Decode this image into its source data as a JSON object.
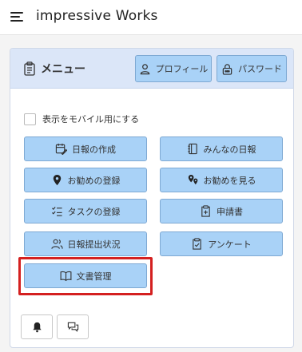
{
  "app": {
    "title": "impressive Works"
  },
  "card": {
    "title": "メニュー",
    "profile_label": "プロフィール",
    "password_label": "パスワード"
  },
  "mobile_toggle": {
    "label": "表示をモバイル用にする",
    "checked": false
  },
  "menu_buttons": [
    {
      "label": "日報の作成",
      "icon": "calendar-edit-icon"
    },
    {
      "label": "みんなの日報",
      "icon": "notebook-icon"
    },
    {
      "label": "お勧めの登録",
      "icon": "map-pin-icon"
    },
    {
      "label": "お勧めを見る",
      "icon": "map-pins-icon"
    },
    {
      "label": "タスクの登録",
      "icon": "checklist-icon"
    },
    {
      "label": "申請書",
      "icon": "clipboard-plus-icon"
    },
    {
      "label": "日報提出状況",
      "icon": "users-icon"
    },
    {
      "label": "アンケート",
      "icon": "clipboard-check-icon"
    },
    {
      "label": "文書管理",
      "icon": "open-book-icon"
    }
  ],
  "bottom_buttons": [
    {
      "icon": "bell-icon"
    },
    {
      "icon": "chat-bubbles-icon"
    }
  ],
  "colors": {
    "button_fill": "#a9d2f7",
    "header_fill": "#dbe6f8",
    "highlight": "#d42020"
  }
}
